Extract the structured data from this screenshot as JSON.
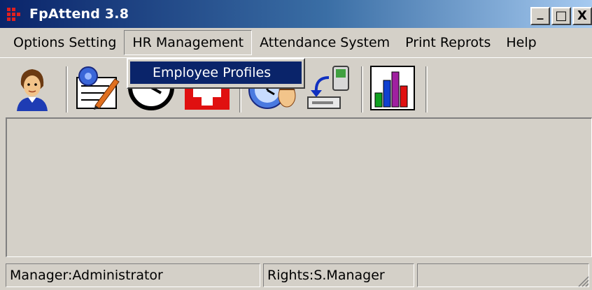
{
  "window": {
    "title": "FpAttend 3.8",
    "controls": {
      "minimize": "_",
      "maximize": "□",
      "close": "X"
    }
  },
  "menubar": {
    "items": [
      {
        "label": "Options Setting"
      },
      {
        "label": "HR Management",
        "active": true
      },
      {
        "label": "Attendance System"
      },
      {
        "label": "Print Reprots"
      },
      {
        "label": "Help"
      }
    ]
  },
  "dropdown": {
    "parent": "HR Management",
    "items": [
      {
        "label": "Employee Profiles",
        "highlighted": true
      }
    ]
  },
  "toolbar": {
    "buttons": [
      {
        "icon": "employee-person-icon"
      },
      {
        "icon": "edit-document-icon"
      },
      {
        "icon": "clock-icon"
      },
      {
        "icon": "leave-red-cross-icon"
      },
      {
        "icon": "clock-face-icon"
      },
      {
        "icon": "device-download-icon"
      },
      {
        "icon": "bar-chart-report-icon"
      }
    ]
  },
  "statusbar": {
    "user": "Manager:Administrator",
    "rights": "Rights:S.Manager",
    "extra": ""
  },
  "colors": {
    "titlebar_start": "#0a246a",
    "titlebar_end": "#a6caf0",
    "highlight": "#0a246a",
    "face": "#d4d0c8"
  }
}
